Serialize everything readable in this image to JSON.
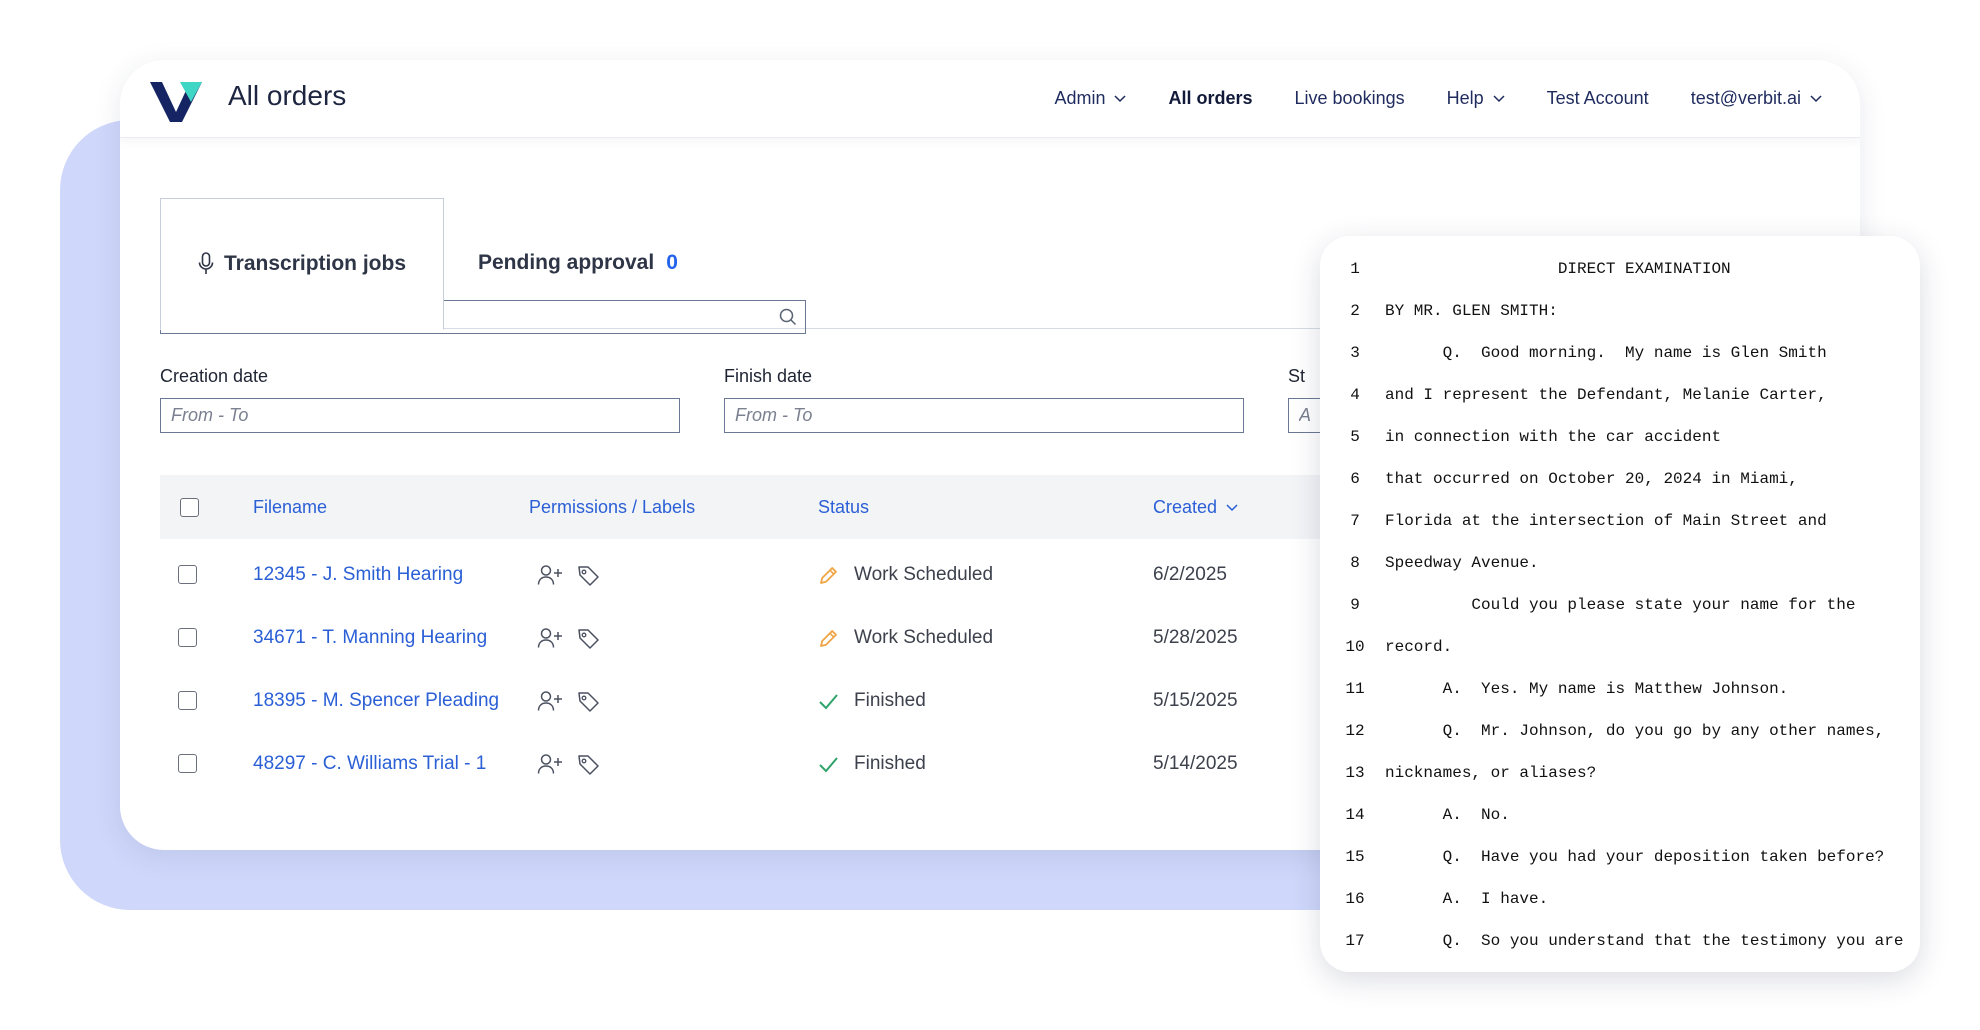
{
  "header": {
    "title": "All orders",
    "nav": [
      {
        "label": "Admin",
        "dropdown": true
      },
      {
        "label": "All orders",
        "active": true
      },
      {
        "label": "Live bookings"
      },
      {
        "label": "Help",
        "dropdown": true
      },
      {
        "label": "Test Account"
      },
      {
        "label": "test@verbit.ai",
        "dropdown": true
      }
    ]
  },
  "tabs": {
    "transcription_label": "Transcription jobs",
    "pending_label": "Pending approval",
    "pending_count": "0"
  },
  "search": {
    "placeholder": "Search"
  },
  "filters": {
    "creation_label": "Creation date",
    "creation_placeholder": "From - To",
    "finish_label": "Finish date",
    "finish_placeholder": "From - To",
    "third_label_partial": "St",
    "third_placeholder_partial": "A"
  },
  "table": {
    "columns": {
      "filename": "Filename",
      "permissions": "Permissions / Labels",
      "status": "Status",
      "created": "Created"
    },
    "rows": [
      {
        "filename": "12345 - J. Smith Hearing",
        "status": "Work Scheduled",
        "status_icon": "pencil-icon",
        "created": "6/2/2025"
      },
      {
        "filename": "34671 - T. Manning Hearing",
        "status": "Work Scheduled",
        "status_icon": "pencil-icon",
        "created": "5/28/2025"
      },
      {
        "filename": "18395 - M. Spencer Pleading",
        "status": "Finished",
        "status_icon": "check-icon",
        "created": "5/15/2025"
      },
      {
        "filename": "48297 - C. Williams Trial - 1",
        "status": "Finished",
        "status_icon": "check-icon",
        "created": "5/14/2025"
      }
    ]
  },
  "transcript": {
    "lines": [
      {
        "n": "1",
        "text": "                  DIRECT EXAMINATION"
      },
      {
        "n": "2",
        "text": "BY MR. GLEN SMITH:"
      },
      {
        "n": "3",
        "text": "      Q.  Good morning.  My name is Glen Smith"
      },
      {
        "n": "4",
        "text": "and I represent the Defendant, Melanie Carter,"
      },
      {
        "n": "5",
        "text": "in connection with the car accident"
      },
      {
        "n": "6",
        "text": "that occurred on October 20, 2024 in Miami,"
      },
      {
        "n": "7",
        "text": "Florida at the intersection of Main Street and"
      },
      {
        "n": "8",
        "text": "Speedway Avenue."
      },
      {
        "n": "9",
        "text": "         Could you please state your name for the"
      },
      {
        "n": "10",
        "text": "record."
      },
      {
        "n": "11",
        "text": "      A.  Yes. My name is Matthew Johnson."
      },
      {
        "n": "12",
        "text": "      Q.  Mr. Johnson, do you go by any other names,"
      },
      {
        "n": "13",
        "text": "nicknames, or aliases?"
      },
      {
        "n": "14",
        "text": "      A.  No."
      },
      {
        "n": "15",
        "text": "      Q.  Have you had your deposition taken before?"
      },
      {
        "n": "16",
        "text": "      A.  I have."
      },
      {
        "n": "17",
        "text": "      Q.  So you understand that the testimony you are"
      }
    ]
  },
  "colors": {
    "accent": "#2a5fd6",
    "backdrop": "#cfd8fb",
    "logo_dark": "#152563",
    "logo_teal": "#3fd6c6",
    "pending": "#f0a545",
    "finished": "#2fa36b"
  }
}
